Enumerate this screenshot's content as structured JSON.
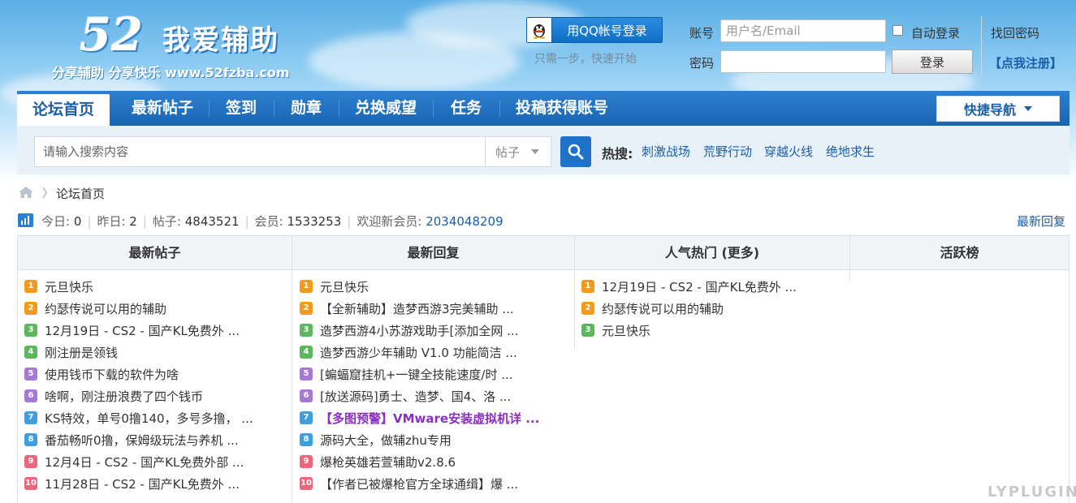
{
  "logo": {
    "number": "52",
    "name": "我爱辅助",
    "slogan": "分享辅助 分享快乐 www.52fzba.com"
  },
  "qq_login": {
    "label": "用QQ帐号登录",
    "hint": "只需一步，快速开始"
  },
  "login": {
    "account_label": "账号",
    "account_placeholder": "用户名/Email",
    "remember_label": "自动登录",
    "forgot_label": "找回密码",
    "password_label": "密码",
    "login_button": "登录",
    "register_label": "【点我注册】"
  },
  "nav": {
    "items": [
      "论坛首页",
      "最新帖子",
      "签到",
      "勋章",
      "兑换威望",
      "任务",
      "投稿获得账号"
    ],
    "quick_nav": "快捷导航"
  },
  "search": {
    "placeholder": "请输入搜索内容",
    "type": "帖子",
    "hot_label": "热搜:",
    "hot_links": [
      "刺激战场",
      "荒野行动",
      "穿越火线",
      "绝地求生"
    ]
  },
  "breadcrumb": {
    "current": "论坛首页"
  },
  "stats": {
    "today_label": "今日:",
    "today": "0",
    "yesterday_label": "昨日:",
    "yesterday": "2",
    "posts_label": "帖子:",
    "posts": "4843521",
    "members_label": "会员:",
    "members": "1533253",
    "welcome_label": "欢迎新会员:",
    "newest_member": "2034048209",
    "latest_reply_link": "最新回复"
  },
  "board": {
    "columns": [
      "最新帖子",
      "最新回复",
      "人气热门 (更多)",
      "活跃榜"
    ],
    "latest_posts": [
      "元旦快乐",
      "约瑟传说可以用的辅助",
      "12月19日 - CS2 - 国产KL免费外 ...",
      "刚注册是领钱",
      "使用钱币下载的软件为啥",
      "啥啊，刚注册浪费了四个钱币",
      "KS特效，单号0撸140，多号多撸， ...",
      "番茄畅听0撸，保姆级玩法与养机 ...",
      "12月4日 - CS2 - 国产KL免费外部 ...",
      "11月28日 - CS2 - 国产KL免费外 ..."
    ],
    "latest_replies": [
      "元旦快乐",
      "【全新辅助】造梦西游3完美辅助 ...",
      "造梦西游4小苏游戏助手[添加全网 ...",
      "造梦西游少年辅助 V1.0 功能简洁 ...",
      "[蝙蝠窟挂机+一键全技能速度/时 ...",
      "[放送源码]勇士、造梦、国4、洛 ...",
      "【多图预警】VMware安装虚拟机详 ...",
      "源码大全，做辅zhu专用",
      "爆枪英雄若萱辅助v2.8.6",
      "【作者已被爆枪官方全球通缉】爆 ..."
    ],
    "popular": [
      "12月19日 - CS2 - 国产KL免费外 ...",
      "约瑟传说可以用的辅助",
      "元旦快乐"
    ]
  },
  "colors": {
    "nav_blue": "#1e6fc2",
    "link_blue": "#1b5ea8",
    "highlight_purple": "#8a2fc0"
  },
  "watermark": "LYPLUGIN"
}
